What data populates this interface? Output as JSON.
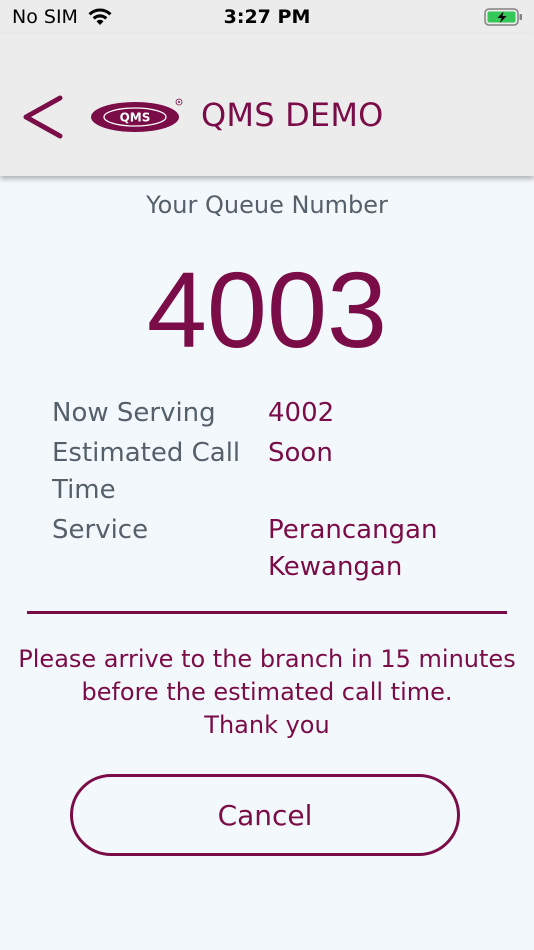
{
  "status_bar": {
    "carrier": "No SIM",
    "time": "3:27 PM",
    "battery_state": "charging"
  },
  "header": {
    "back_icon": "chevron-left-icon",
    "logo_text": "QMS",
    "title": "QMS DEMO"
  },
  "queue": {
    "label": "Your Queue Number",
    "number": "4003"
  },
  "details": [
    {
      "label": "Now Serving",
      "value": "4002"
    },
    {
      "label": "Estimated Call Time",
      "value": "Soon"
    },
    {
      "label": "Service",
      "value": "Perancangan Kewangan"
    }
  ],
  "message": {
    "arrive_text": "Please arrive to the branch in 15 minutes before the estimated call time.",
    "thanks": "Thank you"
  },
  "actions": {
    "cancel_label": "Cancel"
  },
  "colors": {
    "accent": "#7a0c47",
    "label_gray": "#56606a",
    "header_bg": "#ececec",
    "page_bg": "#f3f8fc"
  }
}
